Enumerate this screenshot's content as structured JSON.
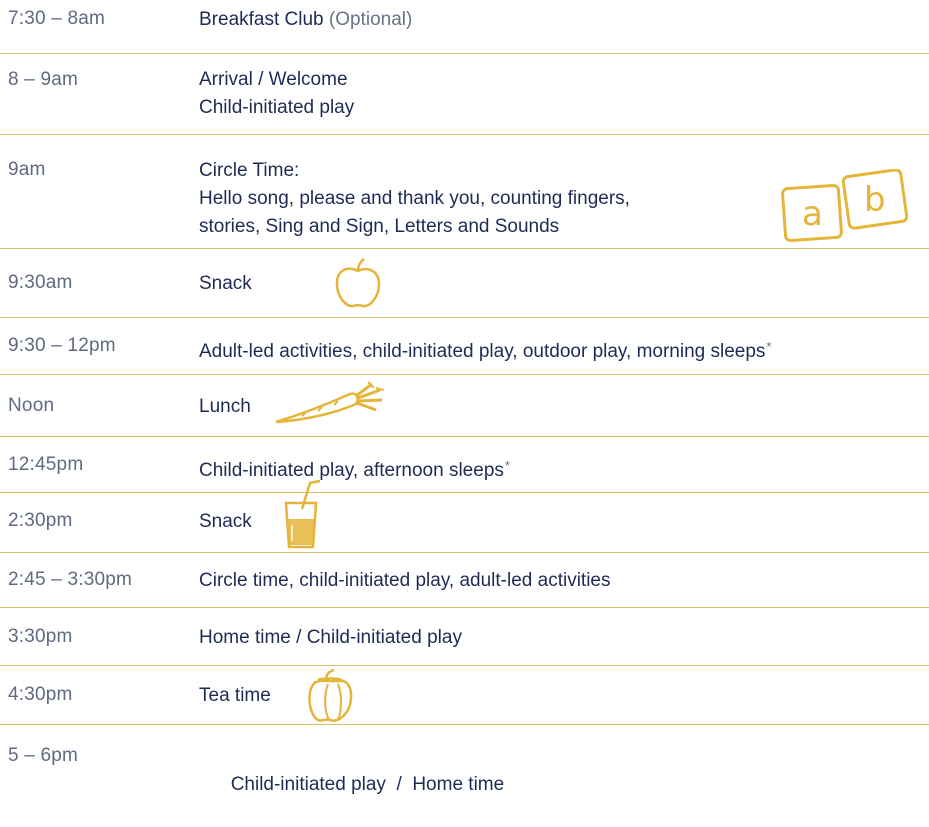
{
  "colors": {
    "accent": "#e5b53a",
    "divider": "#d9c06a",
    "time_text": "#5f6a80",
    "activity_text": "#1f2b55"
  },
  "icons": [
    "abc-blocks-icon",
    "apple-icon",
    "carrot-icon",
    "juice-glass-icon",
    "pepper-icon"
  ],
  "rows": [
    {
      "time": "7:30 – 8am",
      "activity": "Breakfast Club",
      "note": "(Optional)"
    },
    {
      "time": "8 – 9am",
      "lines": [
        "Arrival / Welcome",
        "Child-initiated play"
      ]
    },
    {
      "time": "9am",
      "lines": [
        "Circle Time:",
        "Hello song, please and thank you, counting fingers,",
        "stories, Sing and Sign, Letters and Sounds"
      ],
      "blocks": [
        "a",
        "b"
      ]
    },
    {
      "time": "9:30am",
      "activity": "Snack"
    },
    {
      "time": "9:30 – 12pm",
      "activity": "Adult-led activities, child-initiated play, outdoor play, morning sleeps",
      "mark": "*"
    },
    {
      "time": "Noon",
      "activity": "Lunch"
    },
    {
      "time": "12:45pm",
      "activity": "Child-initiated play, afternoon sleeps",
      "mark": "*"
    },
    {
      "time": "2:30pm",
      "activity": "Snack"
    },
    {
      "time": "2:45 – 3:30pm",
      "activity": "Circle time, child-initiated play, adult-led activities"
    },
    {
      "time": "3:30pm",
      "activity": "Home time / Child-initiated play"
    },
    {
      "time": "4:30pm",
      "activity": "Tea time"
    },
    {
      "time": "5 – 6pm",
      "activity": "Child-initiated play  /  Home time"
    }
  ]
}
